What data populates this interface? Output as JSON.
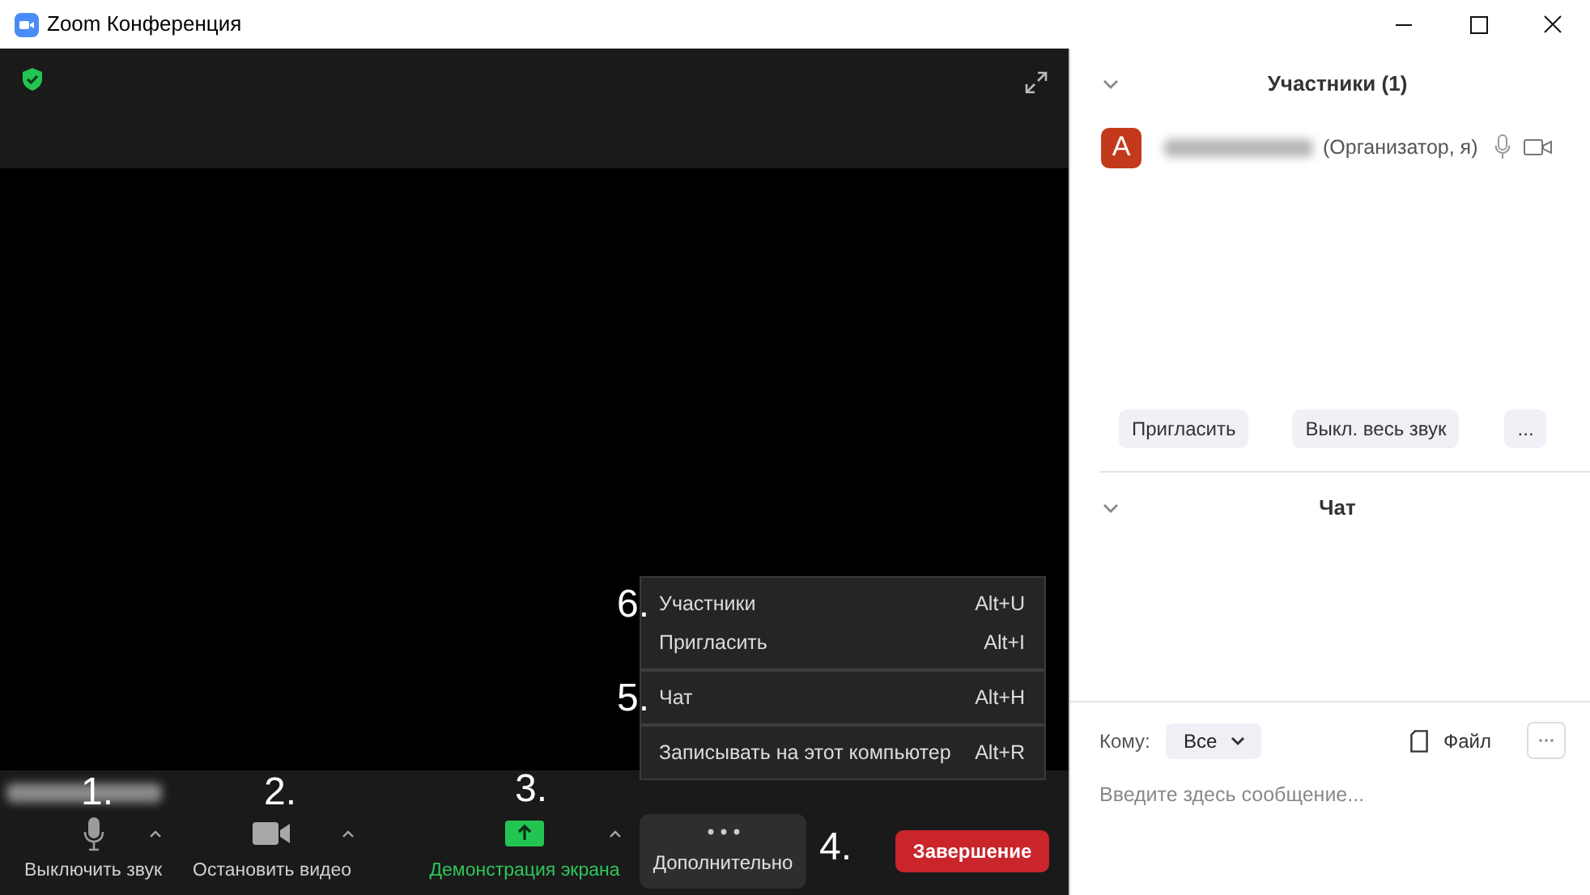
{
  "window": {
    "title": "Zoom Конференция"
  },
  "toolbar": {
    "items": [
      {
        "kind": "mic",
        "label": "Выключить звук",
        "highlighted": false,
        "marker": "1."
      },
      {
        "kind": "video",
        "label": "Остановить видео",
        "highlighted": false,
        "marker": "2."
      },
      {
        "kind": "share",
        "label": "Демонстрация экрана",
        "highlighted": true,
        "marker": "3."
      }
    ],
    "more": {
      "label": "Дополнительно",
      "marker": "4.",
      "expanded": true
    },
    "end_button": "Завершение"
  },
  "more_menu": {
    "sections": [
      [
        {
          "label": "Участники",
          "shortcut": "Alt+U",
          "marker": "6."
        },
        {
          "label": "Пригласить",
          "shortcut": "Alt+I"
        }
      ],
      [
        {
          "label": "Чат",
          "shortcut": "Alt+H",
          "marker": "5."
        }
      ],
      [
        {
          "label": "Записывать на этот компьютер",
          "shortcut": "Alt+R"
        }
      ]
    ]
  },
  "participants": {
    "title": "Участники (1)",
    "expanded": true,
    "list": [
      {
        "initial": "А",
        "role": "(Организатор, я)",
        "color": "#c23a1b"
      }
    ],
    "buttons": [
      "Пригласить",
      "Выкл. весь звук",
      "..."
    ]
  },
  "chat": {
    "title": "Чат",
    "expanded": true,
    "to_label": "Кому:",
    "recipient": "Все",
    "file_label": "Файл",
    "placeholder": "Введите здесь сообщение..."
  }
}
